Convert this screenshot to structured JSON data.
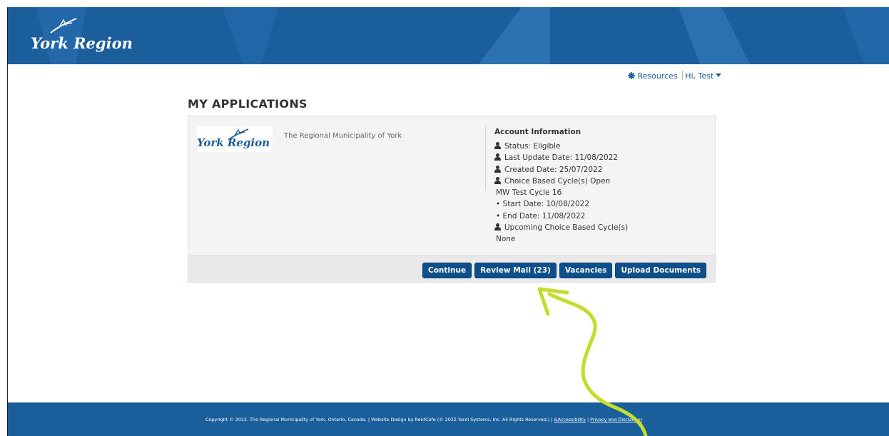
{
  "header": {
    "logo_text": "York Region"
  },
  "topnav": {
    "resources": "Resources",
    "user_menu": "Hi, Test"
  },
  "page": {
    "title": "MY APPLICATIONS"
  },
  "card": {
    "logo_text": "York Region",
    "org_name": "The Regional Municipality of York",
    "account_title": "Account Information",
    "lines": {
      "status": "Status: Eligible",
      "last_update": "Last Update Date: 11/08/2022",
      "created": "Created Date: 25/07/2022",
      "cycle_open": "Choice Based Cycle(s) Open",
      "cycle_name": "MW Test Cycle 16",
      "start_date": "• Start Date: 10/08/2022",
      "end_date": "• End Date: 11/08/2022",
      "upcoming": "Upcoming Choice Based Cycle(s)",
      "upcoming_value": "None"
    },
    "buttons": {
      "continue": "Continue",
      "review_mail": "Review Mail (23)",
      "vacancies": "Vacancies",
      "upload": "Upload Documents"
    }
  },
  "footer": {
    "copyright": "Copyright © 2022. The Regional Municipality of York, Ontario, Canada. | Website Design by RentCafe (© 2022 Yardi Systems, Inc. All Rights Reserved.) | ",
    "accessibility": "&Accessibility",
    "sep": " | ",
    "privacy": "Privacy and Disclaimer"
  },
  "colors": {
    "header_blue": "#1b5e9c",
    "button_blue": "#0d4f8b",
    "annotation_green": "#c6dc2c"
  },
  "icons": [
    "person-icon",
    "gear-icon",
    "caret-down-icon",
    "bird-logo-icon"
  ]
}
